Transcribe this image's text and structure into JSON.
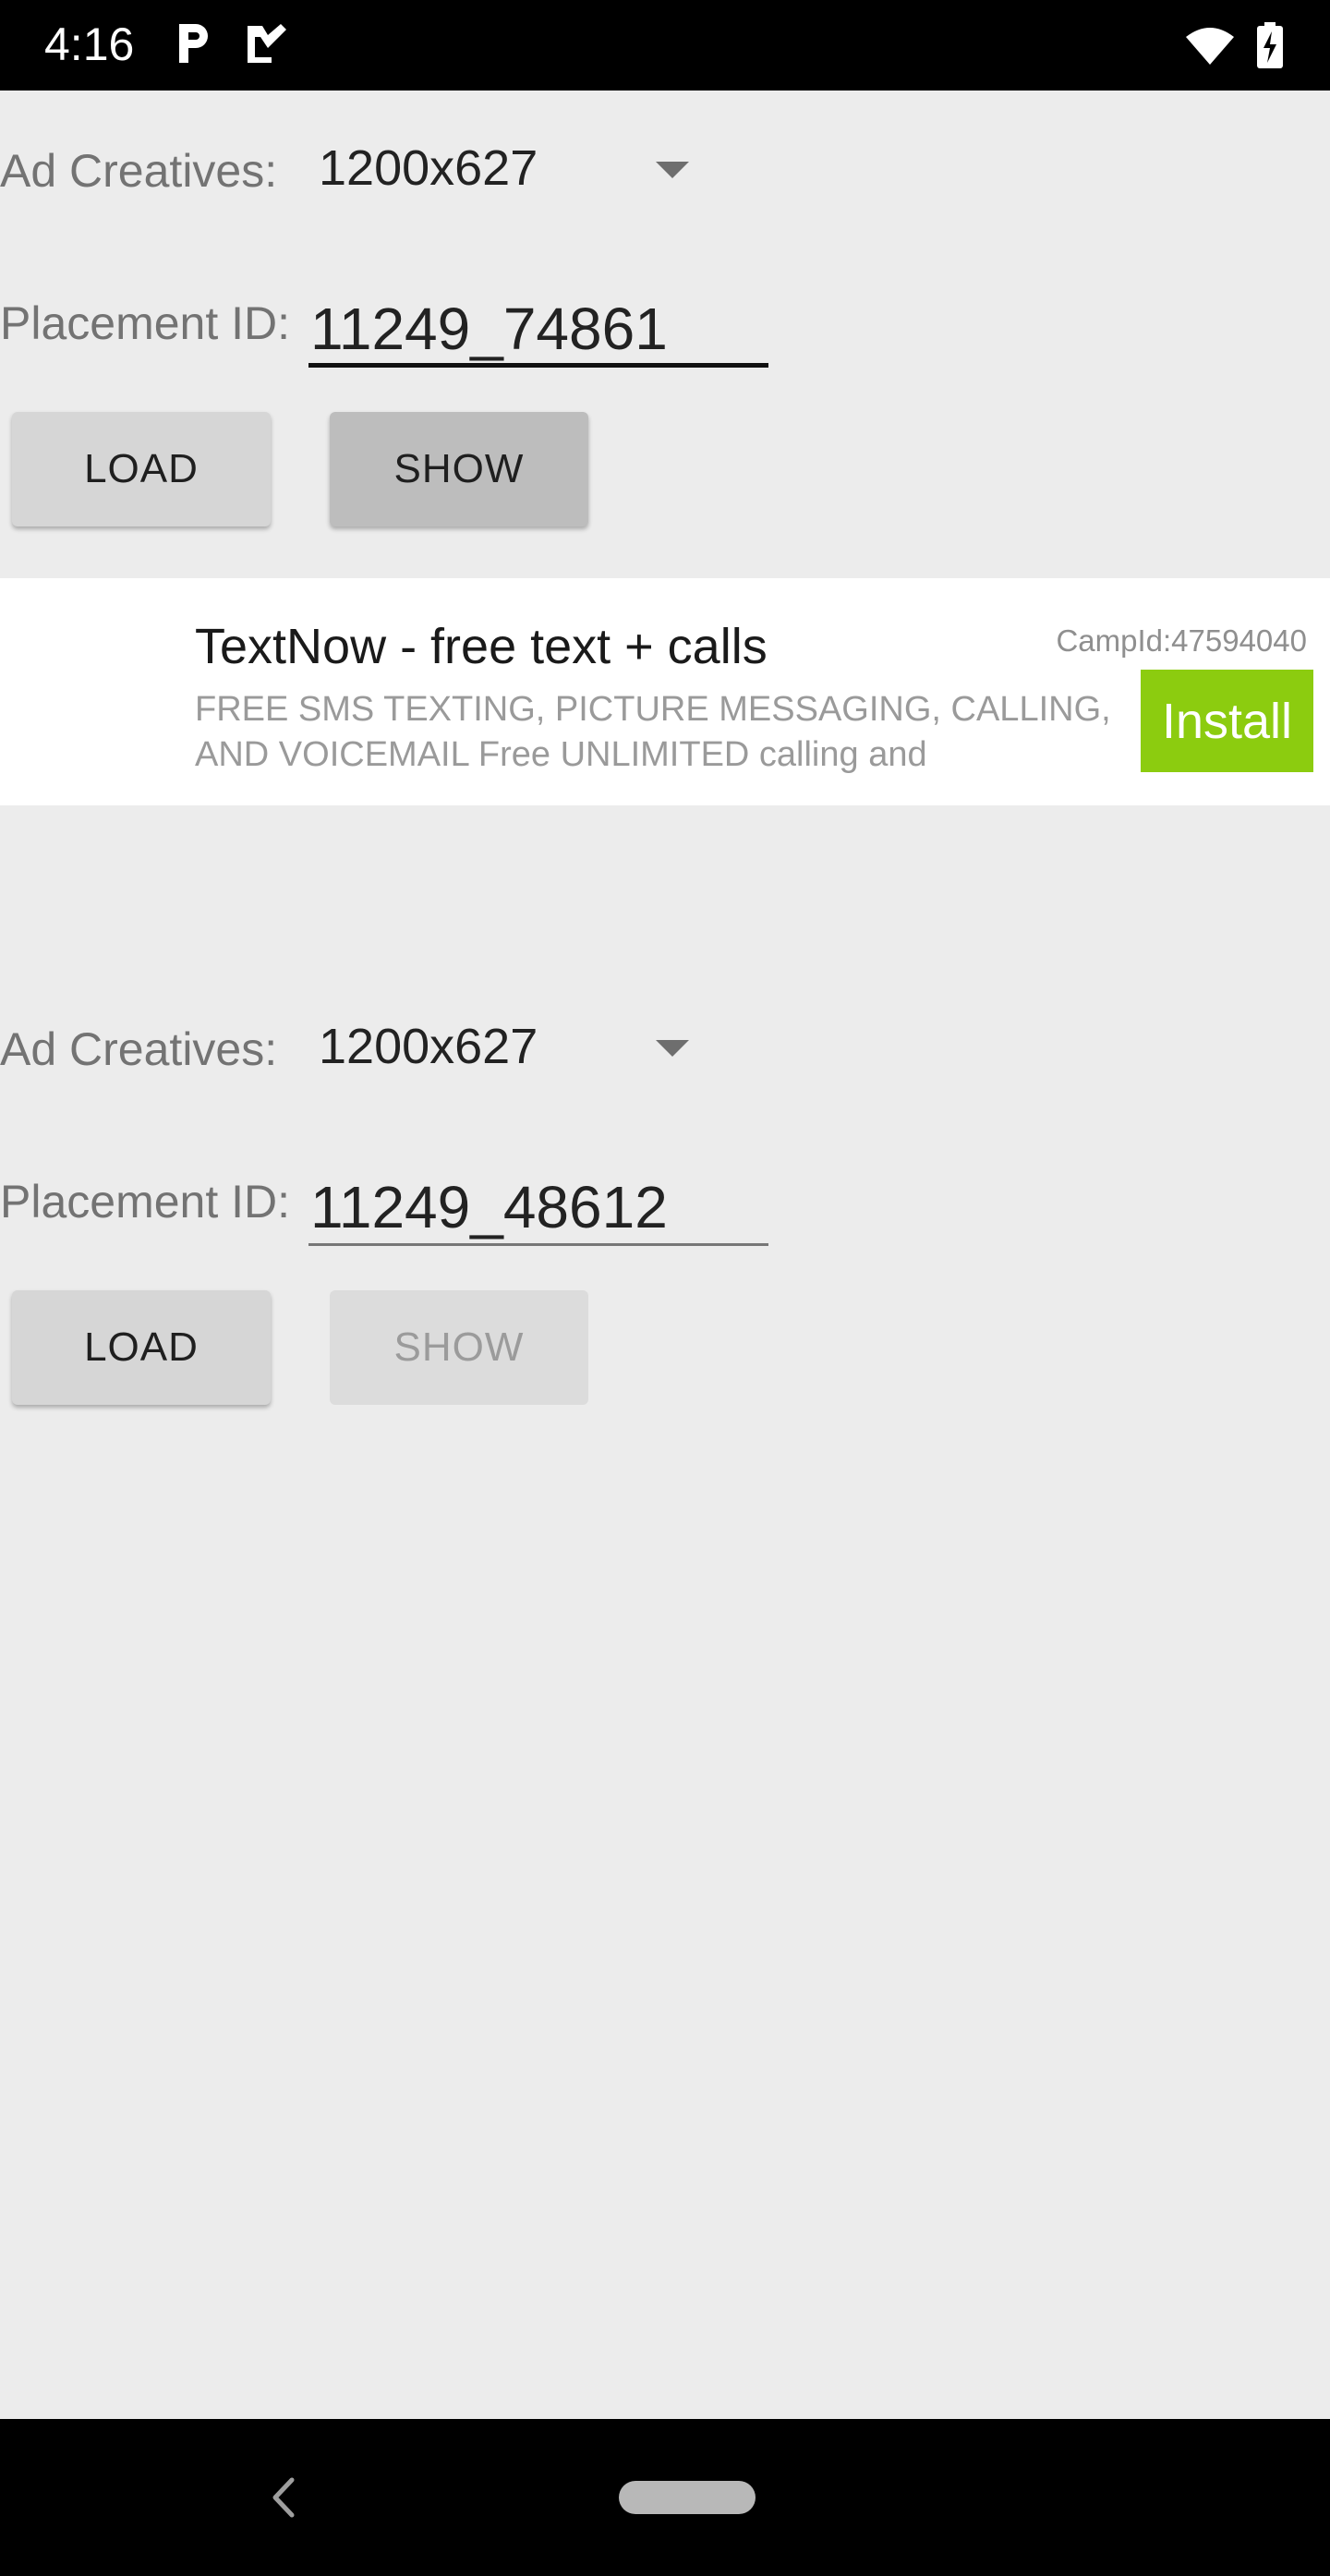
{
  "status_bar": {
    "time": "4:16",
    "icons": [
      "p-app-icon",
      "checkmark-app-icon",
      "wifi-icon",
      "battery-charging-icon"
    ]
  },
  "sections": [
    {
      "ad_creatives_label": "Ad Creatives:",
      "ad_creatives_value": "1200x627",
      "placement_label": "Placement ID:",
      "placement_value": "11249_74861",
      "load_label": "LOAD",
      "show_label": "SHOW",
      "show_enabled": true,
      "field_focused": true
    },
    {
      "ad_creatives_label": "Ad Creatives:",
      "ad_creatives_value": "1200x627",
      "placement_label": "Placement ID:",
      "placement_value": "11249_48612",
      "load_label": "LOAD",
      "show_label": "SHOW",
      "show_enabled": false,
      "field_focused": false
    }
  ],
  "ad": {
    "title": "TextNow - free text + calls",
    "camp_id": "CampId:47594040",
    "description": "FREE SMS TEXTING, PICTURE MESSAGING, CALLING, AND VOICEMAIL Free UNLIMITED calling and",
    "install_label": "Install",
    "install_color": "#8ccc0f"
  },
  "nav_bar": {
    "icons": [
      "back-icon",
      "home-pill-icon"
    ]
  }
}
